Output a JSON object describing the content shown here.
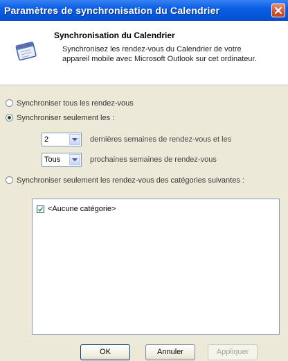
{
  "window": {
    "title": "Paramètres de synchronisation du Calendrier"
  },
  "header": {
    "title": "Synchronisation du Calendrier",
    "description": "Synchronisez les rendez-vous du Calendrier de votre appareil mobile avec Microsoft Outlook sur cet ordinateur."
  },
  "options": {
    "all": {
      "label": "Synchroniser tous les rendez-vous",
      "selected": false
    },
    "only": {
      "label": "Synchroniser seulement les :",
      "selected": true
    },
    "categories": {
      "label": "Synchroniser seulement les rendez-vous des catégories suivantes :",
      "selected": false
    }
  },
  "past": {
    "value": "2",
    "label": "dernières semaines de rendez-vous et les"
  },
  "future": {
    "value": "Tous",
    "label": "prochaines semaines de rendez-vous"
  },
  "category_list": [
    {
      "label": "<Aucune catégorie>",
      "checked": true
    }
  ],
  "buttons": {
    "ok": "OK",
    "cancel": "Annuler",
    "apply": "Appliquer"
  }
}
